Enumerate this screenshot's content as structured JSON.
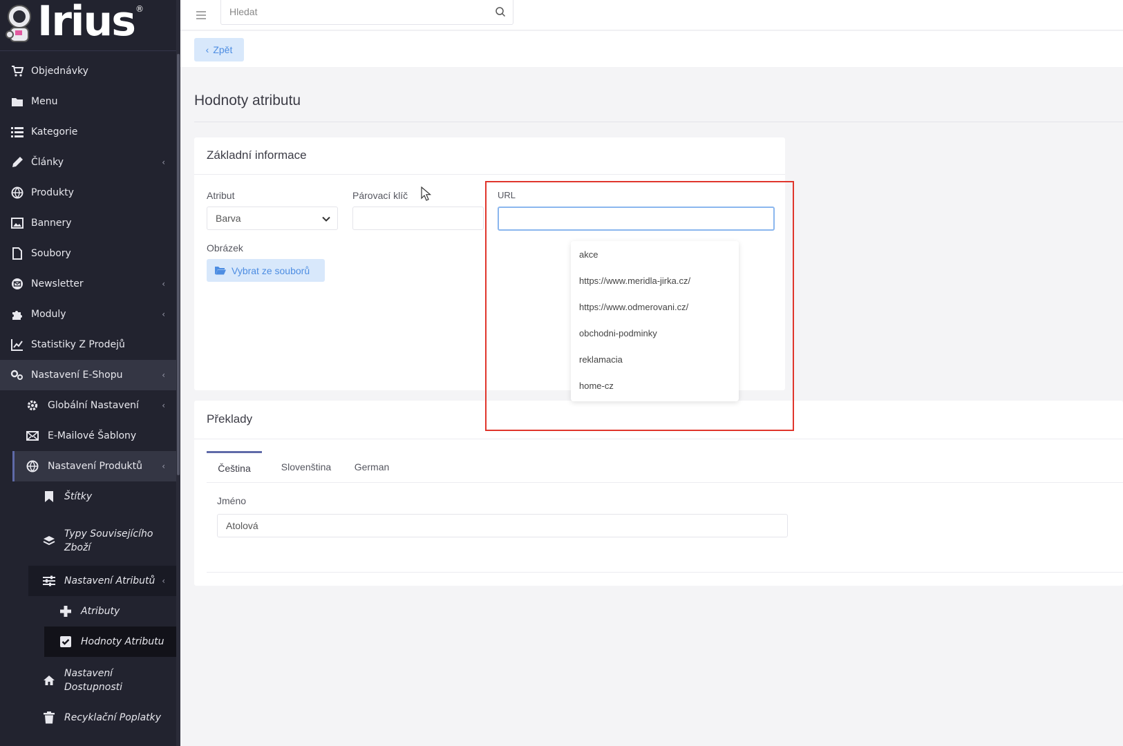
{
  "brand": {
    "name": "Irius",
    "reg": "®"
  },
  "sidebar": {
    "items": [
      {
        "label": "Objednávky",
        "icon": "cart-icon"
      },
      {
        "label": "Menu",
        "icon": "folder-icon"
      },
      {
        "label": "Kategorie",
        "icon": "list-icon"
      },
      {
        "label": "Články",
        "icon": "pencil-icon"
      },
      {
        "label": "Produkty",
        "icon": "ball-icon"
      },
      {
        "label": "Bannery",
        "icon": "image-icon"
      },
      {
        "label": "Soubory",
        "icon": "file-icon"
      },
      {
        "label": "Newsletter",
        "icon": "mail-circle-icon"
      },
      {
        "label": "Moduly",
        "icon": "puzzle-icon"
      },
      {
        "label": "Statistiky Z Prodejů",
        "icon": "chart-line-icon"
      },
      {
        "label": "Nastavení E-Shopu",
        "icon": "cogs-icon"
      },
      {
        "label": "Globální Nastavení",
        "icon": "gear-icon"
      },
      {
        "label": "E-Mailové Šablony",
        "icon": "envelope-icon"
      },
      {
        "label": "Nastavení Produktů",
        "icon": "ball-icon"
      },
      {
        "label": "Štítky",
        "icon": "bookmark-icon"
      },
      {
        "label": "Typy Souvisejícího\nZboží",
        "icon": "layers-icon"
      },
      {
        "label": "Nastavení Atributů",
        "icon": "sliders-icon"
      },
      {
        "label": "Atributy",
        "icon": "plus-icon"
      },
      {
        "label": "Hodnoty Atributu",
        "icon": "checkbox-icon"
      },
      {
        "label": "Nastavení\nDostupnosti",
        "icon": "home-icon"
      },
      {
        "label": "Recyklační Poplatky",
        "icon": "trash-icon"
      }
    ],
    "chevron": "‹"
  },
  "topbar": {
    "search_placeholder": "Hledat"
  },
  "subbar": {
    "back_label": "Zpět",
    "back_chevron": "‹"
  },
  "page": {
    "title": "Hodnoty atributu"
  },
  "basic": {
    "title": "Základní informace",
    "attribute_label": "Atribut",
    "attribute_value": "Barva",
    "pairing_key_label": "Párovací klíč",
    "image_label": "Obrázek",
    "file_button": "Vybrat ze souborů",
    "url_label": "URL",
    "url_value": ""
  },
  "url_suggestions": [
    "akce",
    "https://www.meridla-jirka.cz/",
    "https://www.odmerovani.cz/",
    "obchodni-podminky",
    "reklamacia",
    "home-cz"
  ],
  "translations": {
    "title": "Překlady",
    "tabs": [
      "Čeština",
      "Slovenština",
      "German"
    ],
    "active_tab": "Čeština",
    "name_label": "Jméno",
    "name_value": "Atolová"
  },
  "colors": {
    "sidebar_bg": "#22232f",
    "accent": "#5f6aa8",
    "button_bg": "#d8e8fb",
    "button_text": "#4d8de2",
    "highlight": "#e0352b"
  }
}
